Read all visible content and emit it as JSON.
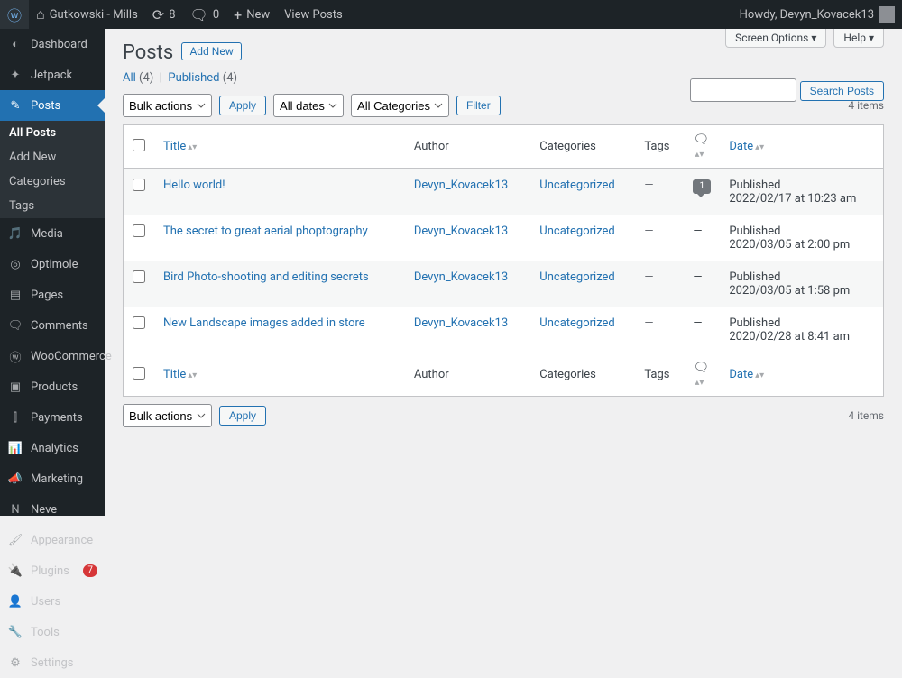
{
  "adminbar": {
    "site_name": "Gutkowski - Mills",
    "updates": "8",
    "comments": "0",
    "new_label": "New",
    "view_posts": "View Posts",
    "howdy": "Howdy, Devyn_Kovacek13"
  },
  "sidebar": {
    "items": [
      {
        "icon": "dashboard",
        "label": "Dashboard"
      },
      {
        "icon": "jetpack",
        "label": "Jetpack"
      },
      {
        "icon": "pin",
        "label": "Posts"
      },
      {
        "icon": "media",
        "label": "Media"
      },
      {
        "icon": "optimole",
        "label": "Optimole"
      },
      {
        "icon": "page",
        "label": "Pages"
      },
      {
        "icon": "comments",
        "label": "Comments"
      },
      {
        "icon": "woo",
        "label": "WooCommerce"
      },
      {
        "icon": "products",
        "label": "Products"
      },
      {
        "icon": "payments",
        "label": "Payments"
      },
      {
        "icon": "analytics",
        "label": "Analytics"
      },
      {
        "icon": "marketing",
        "label": "Marketing"
      },
      {
        "icon": "neve",
        "label": "Neve"
      },
      {
        "icon": "appearance",
        "label": "Appearance"
      },
      {
        "icon": "plugins",
        "label": "Plugins",
        "badge": "7"
      },
      {
        "icon": "users",
        "label": "Users"
      },
      {
        "icon": "tools",
        "label": "Tools"
      },
      {
        "icon": "settings",
        "label": "Settings"
      }
    ],
    "submenu": [
      "All Posts",
      "Add New",
      "Categories",
      "Tags"
    ]
  },
  "page": {
    "title": "Posts",
    "add_new": "Add New",
    "screen_options": "Screen Options",
    "help": "Help",
    "filter_all": "All",
    "filter_all_count": "(4)",
    "filter_published": "Published",
    "filter_published_count": "(4)",
    "search_button": "Search Posts",
    "bulk_actions": "Bulk actions",
    "apply": "Apply",
    "all_dates": "All dates",
    "all_categories": "All Categories",
    "filter": "Filter",
    "items_count": "4 items",
    "cols": {
      "title": "Title",
      "author": "Author",
      "categories": "Categories",
      "tags": "Tags",
      "date": "Date"
    }
  },
  "posts": [
    {
      "title": "Hello world!",
      "author": "Devyn_Kovacek13",
      "category": "Uncategorized",
      "tags": "—",
      "comments": "1",
      "status": "Published",
      "date": "2022/02/17 at 10:23 am"
    },
    {
      "title": "The secret to great aerial phoptography",
      "author": "Devyn_Kovacek13",
      "category": "Uncategorized",
      "tags": "—",
      "comments": "",
      "status": "Published",
      "date": "2020/03/05 at 2:00 pm"
    },
    {
      "title": "Bird Photo-shooting and editing secrets",
      "author": "Devyn_Kovacek13",
      "category": "Uncategorized",
      "tags": "—",
      "comments": "",
      "status": "Published",
      "date": "2020/03/05 at 1:58 pm"
    },
    {
      "title": "New Landscape images added in store",
      "author": "Devyn_Kovacek13",
      "category": "Uncategorized",
      "tags": "—",
      "comments": "",
      "status": "Published",
      "date": "2020/02/28 at 8:41 am"
    }
  ]
}
